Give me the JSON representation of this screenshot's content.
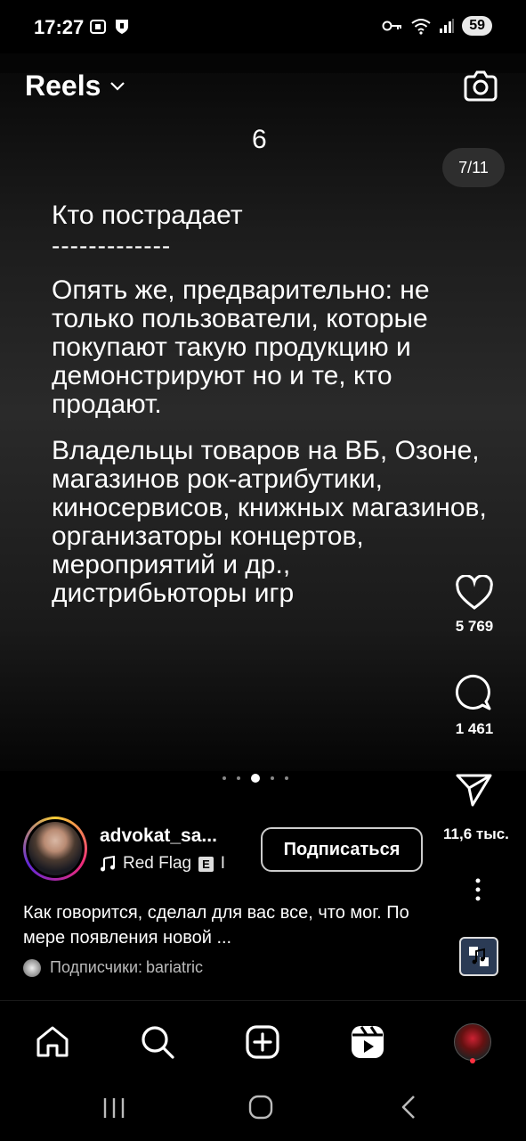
{
  "status": {
    "time": "17:27",
    "battery": "59"
  },
  "header": {
    "title": "Reels",
    "camera_icon": "camera-icon",
    "chevron_icon": "chevron-down-icon"
  },
  "post": {
    "slide_number": "6",
    "page_counter": "7/11",
    "heading": "Кто пострадает",
    "divider": "-------------",
    "paragraph1": "Опять же, предварительно: не только пользователи, которые покупают такую продукцию и демонстрируют но и те, кто продают.",
    "paragraph2": "Владельцы товаров на ВБ, Озоне, магазинов рок-атрибутики, киносервисов, книжных магазинов, организаторы концертов, мероприятий и др., дистрибьюторы игр"
  },
  "actions": {
    "likes": "5 769",
    "comments": "1 461",
    "shares": "11,6 тыс."
  },
  "author": {
    "name": "advokat_sa...",
    "music": "Red Flag",
    "music_badge": "E",
    "music_extra": "I",
    "follow_label": "Подписаться"
  },
  "caption": {
    "text": "Как говорится, сделал для вас все, что мог. По мере появления новой ...",
    "followers_label": "Подписчики:",
    "followers_name": "bariatric"
  },
  "nav": {
    "items": [
      "home-icon",
      "search-icon",
      "create-icon",
      "reels-icon",
      "profile-avatar"
    ]
  }
}
